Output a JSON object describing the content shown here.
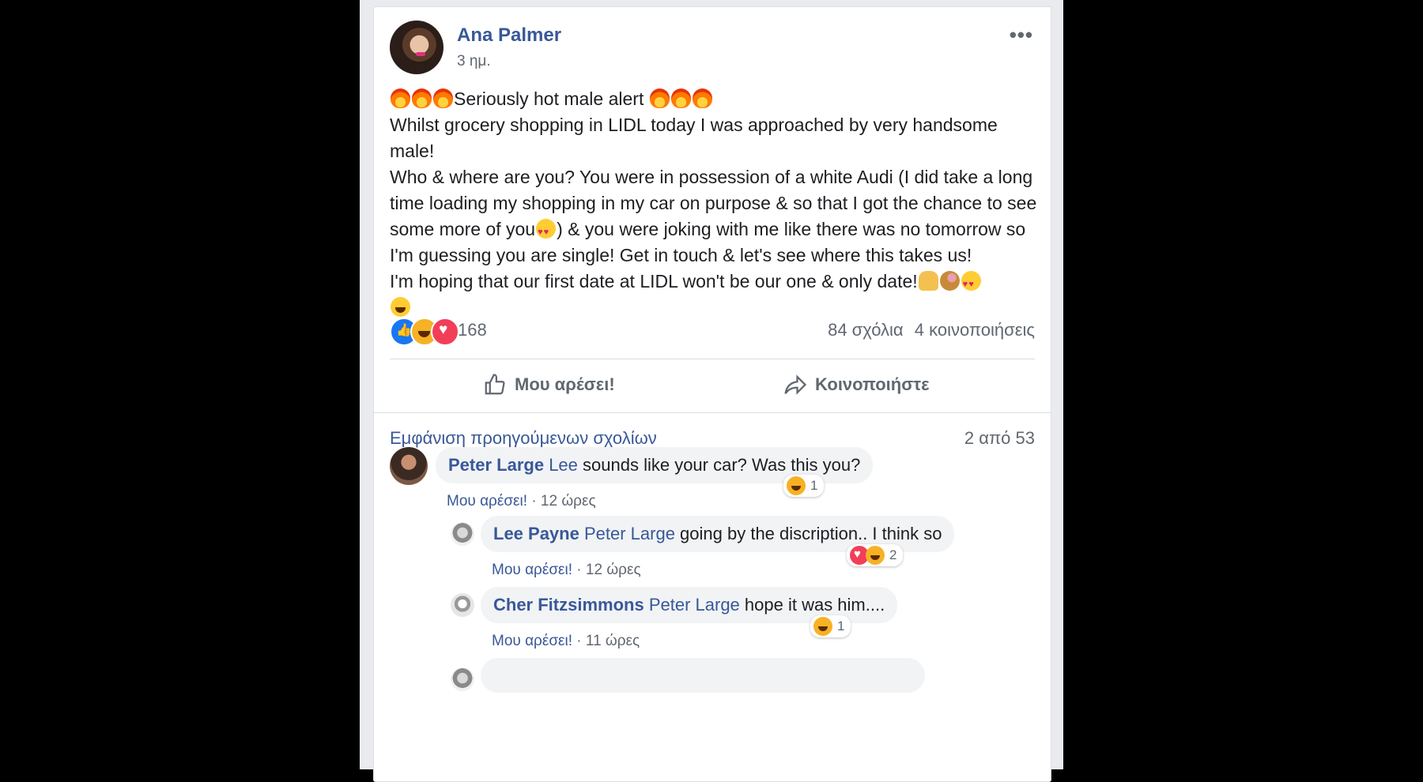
{
  "post": {
    "author": "Ana Palmer",
    "time": "3 ημ.",
    "more_label": "•••",
    "line1_text": "Seriously hot male alert ",
    "line2": "Whilst grocery shopping in LIDL today I was approached by very handsome male!",
    "line3a": "Who & where are you? You were in possession of a white Audi (I did take a long time loading my shopping in my car on purpose & so that I got the chance to see some more of you",
    "line3b": ") & you were joking with me like there was no tomorrow so I'm guessing you are single! Get in touch & let's see where this takes us!",
    "line4": "I'm hoping that our first date at LIDL won't be our one & only date!",
    "reaction_count": "168",
    "comments_count": "84 σχόλια",
    "shares_count": "4 κοινοποιήσεις",
    "like_label": "Μου αρέσει!",
    "share_label": "Κοινοποιήστε"
  },
  "comments_section": {
    "view_previous": "Εμφάνιση προηγούμενων σχολίων",
    "count": "2 από 53",
    "like_label": "Μου αρέσει!",
    "items": [
      {
        "name": "Peter Large",
        "tag": "Lee",
        "text": " sounds like your car? Was this you?",
        "time": "12 ώρες",
        "reactions": "1"
      },
      {
        "name": "Lee Payne",
        "tag": "Peter Large",
        "text": " going by the discription.. I think so",
        "time": "12 ώρες",
        "reactions": "2"
      },
      {
        "name": "Cher Fitzsimmons",
        "tag": "Peter Large",
        "text": " hope it was him....",
        "time": "11 ώρες",
        "reactions": "1"
      }
    ]
  },
  "colors": {
    "link": "#385898",
    "muted": "#606770",
    "like_blue": "#1877f2",
    "love_red": "#f33e58",
    "haha_yellow": "#f7b125"
  }
}
